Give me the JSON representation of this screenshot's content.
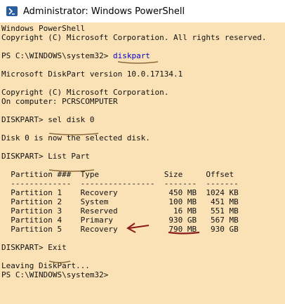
{
  "window": {
    "title": "Administrator: Windows PowerShell",
    "icon": "powershell-icon"
  },
  "console": {
    "lines": [
      "Windows PowerShell",
      "Copyright (C) Microsoft Corporation. All rights reserved.",
      "",
      "PS C:\\WINDOWS\\system32> ",
      "",
      "Microsoft DiskPart version 10.0.17134.1",
      "",
      "Copyright (C) Microsoft Corporation.",
      "On computer: PCRSCOMPUTER",
      "",
      "DISKPART> ",
      "",
      "Disk 0 is now the selected disk.",
      "",
      "DISKPART> ",
      "",
      "  Partition ###  Type              Size     Offset",
      "  -------------  ----------------  -------  -------",
      "  Partition 1    Recovery           450 MB  1024 KB",
      "  Partition 2    System             100 MB   451 MB",
      "  Partition 3    Reserved            16 MB   551 MB",
      "  Partition 4    Primary            930 GB   567 MB",
      "  Partition 5    Recovery           790 MB   930 GB",
      "",
      "DISKPART> ",
      "",
      "Leaving DiskPart...",
      "PS C:\\WINDOWS\\system32> "
    ],
    "commands": {
      "diskpart": "diskpart",
      "sel_disk": "sel disk 0",
      "list_part": "List Part",
      "exit": "Exit"
    }
  },
  "colors": {
    "console_bg": "#fbe2b6",
    "console_text": "#111111",
    "command_highlight": "#0000c8",
    "annotation": "#8b1a1a"
  }
}
